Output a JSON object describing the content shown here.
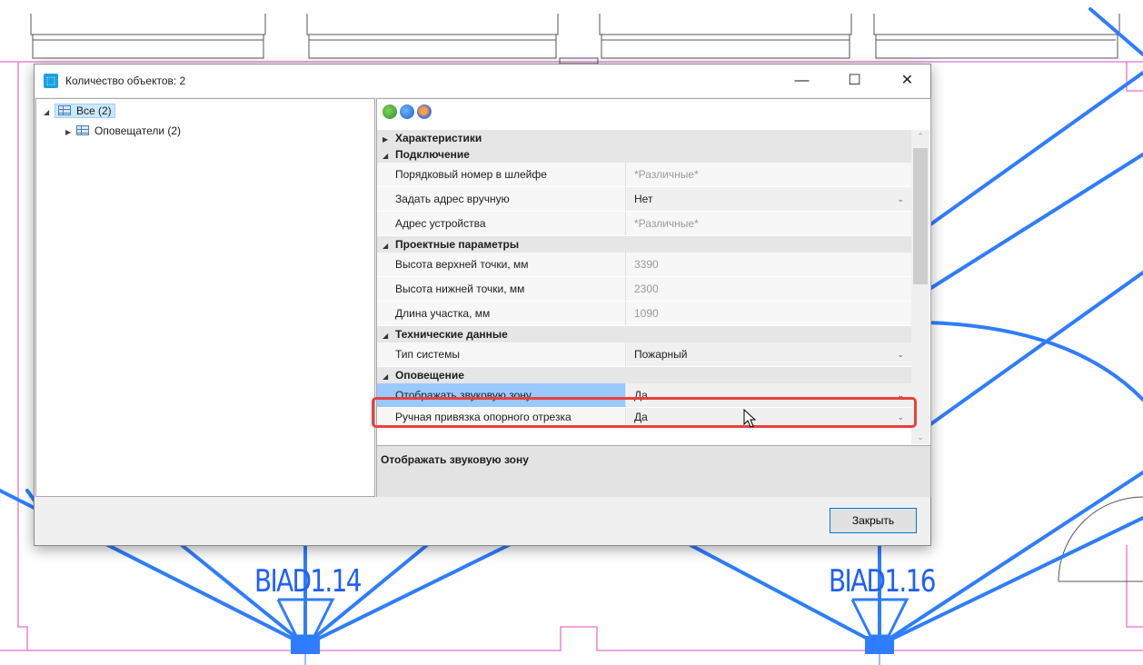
{
  "window": {
    "title": "Количество объектов: 2",
    "minimize": "—",
    "maximize": "☐",
    "close": "✕"
  },
  "tree": {
    "items": [
      {
        "label": "Все (2)",
        "expanded": true,
        "selected": true
      },
      {
        "label": "Оповещатели (2)",
        "expanded": false,
        "selected": false
      }
    ]
  },
  "toolbar": {
    "icons": [
      "refresh-all-icon",
      "refresh-icon",
      "settings-icon"
    ]
  },
  "properties": [
    {
      "type": "category",
      "label": "Характеристики",
      "expanded": false
    },
    {
      "type": "category",
      "label": "Подключение",
      "expanded": true
    },
    {
      "type": "property",
      "name": "Порядковый номер в шлейфе",
      "value": "*Различные*",
      "gray": true
    },
    {
      "type": "property",
      "name": "Задать адрес вручную",
      "value": "Нет",
      "combo": true
    },
    {
      "type": "property",
      "name": "Адрес устройства",
      "value": "*Различные*",
      "gray": true
    },
    {
      "type": "category",
      "label": "Проектные параметры",
      "expanded": true
    },
    {
      "type": "property",
      "name": "Высота верхней точки, мм",
      "value": "3390",
      "gray": true
    },
    {
      "type": "property",
      "name": "Высота нижней точки, мм",
      "value": "2300",
      "gray": true
    },
    {
      "type": "property",
      "name": "Длина участка, мм",
      "value": "1090",
      "gray": true
    },
    {
      "type": "category",
      "label": "Технические данные",
      "expanded": true
    },
    {
      "type": "property",
      "name": "Тип системы",
      "value": "Пожарный",
      "combo": true
    },
    {
      "type": "category",
      "label": "Оповещение",
      "expanded": true
    },
    {
      "type": "property",
      "name": "Отображать звуковую зону",
      "value": "Да",
      "combo": true,
      "selected": true
    },
    {
      "type": "property",
      "name": "Ручная привязка опорного отрезка",
      "value": "Да",
      "combo": true
    }
  ],
  "description": {
    "title": "Отображать звуковую зону"
  },
  "buttons": {
    "close_label": "Закрыть"
  },
  "cad": {
    "labels": [
      "BIAD1.14",
      "BIAD1.16"
    ],
    "line_color": "#2e7dff",
    "wall_color": "#e46fd1"
  }
}
